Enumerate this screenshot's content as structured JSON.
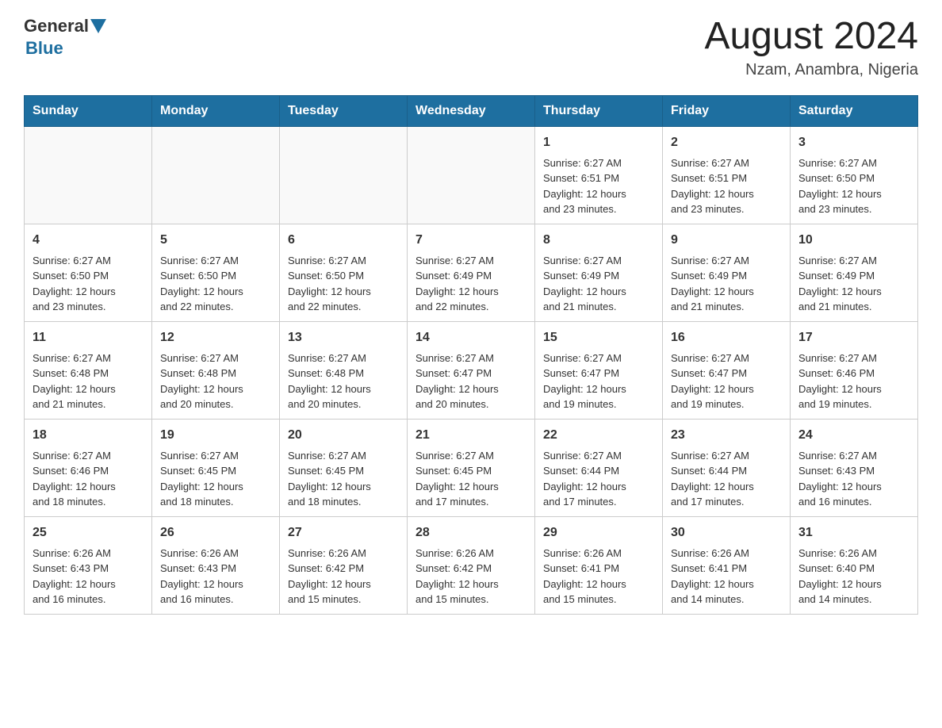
{
  "header": {
    "logo_general": "General",
    "logo_blue": "Blue",
    "month_year": "August 2024",
    "location": "Nzam, Anambra, Nigeria"
  },
  "weekdays": [
    "Sunday",
    "Monday",
    "Tuesday",
    "Wednesday",
    "Thursday",
    "Friday",
    "Saturday"
  ],
  "weeks": [
    [
      {
        "day": "",
        "info": ""
      },
      {
        "day": "",
        "info": ""
      },
      {
        "day": "",
        "info": ""
      },
      {
        "day": "",
        "info": ""
      },
      {
        "day": "1",
        "info": "Sunrise: 6:27 AM\nSunset: 6:51 PM\nDaylight: 12 hours\nand 23 minutes."
      },
      {
        "day": "2",
        "info": "Sunrise: 6:27 AM\nSunset: 6:51 PM\nDaylight: 12 hours\nand 23 minutes."
      },
      {
        "day": "3",
        "info": "Sunrise: 6:27 AM\nSunset: 6:50 PM\nDaylight: 12 hours\nand 23 minutes."
      }
    ],
    [
      {
        "day": "4",
        "info": "Sunrise: 6:27 AM\nSunset: 6:50 PM\nDaylight: 12 hours\nand 23 minutes."
      },
      {
        "day": "5",
        "info": "Sunrise: 6:27 AM\nSunset: 6:50 PM\nDaylight: 12 hours\nand 22 minutes."
      },
      {
        "day": "6",
        "info": "Sunrise: 6:27 AM\nSunset: 6:50 PM\nDaylight: 12 hours\nand 22 minutes."
      },
      {
        "day": "7",
        "info": "Sunrise: 6:27 AM\nSunset: 6:49 PM\nDaylight: 12 hours\nand 22 minutes."
      },
      {
        "day": "8",
        "info": "Sunrise: 6:27 AM\nSunset: 6:49 PM\nDaylight: 12 hours\nand 21 minutes."
      },
      {
        "day": "9",
        "info": "Sunrise: 6:27 AM\nSunset: 6:49 PM\nDaylight: 12 hours\nand 21 minutes."
      },
      {
        "day": "10",
        "info": "Sunrise: 6:27 AM\nSunset: 6:49 PM\nDaylight: 12 hours\nand 21 minutes."
      }
    ],
    [
      {
        "day": "11",
        "info": "Sunrise: 6:27 AM\nSunset: 6:48 PM\nDaylight: 12 hours\nand 21 minutes."
      },
      {
        "day": "12",
        "info": "Sunrise: 6:27 AM\nSunset: 6:48 PM\nDaylight: 12 hours\nand 20 minutes."
      },
      {
        "day": "13",
        "info": "Sunrise: 6:27 AM\nSunset: 6:48 PM\nDaylight: 12 hours\nand 20 minutes."
      },
      {
        "day": "14",
        "info": "Sunrise: 6:27 AM\nSunset: 6:47 PM\nDaylight: 12 hours\nand 20 minutes."
      },
      {
        "day": "15",
        "info": "Sunrise: 6:27 AM\nSunset: 6:47 PM\nDaylight: 12 hours\nand 19 minutes."
      },
      {
        "day": "16",
        "info": "Sunrise: 6:27 AM\nSunset: 6:47 PM\nDaylight: 12 hours\nand 19 minutes."
      },
      {
        "day": "17",
        "info": "Sunrise: 6:27 AM\nSunset: 6:46 PM\nDaylight: 12 hours\nand 19 minutes."
      }
    ],
    [
      {
        "day": "18",
        "info": "Sunrise: 6:27 AM\nSunset: 6:46 PM\nDaylight: 12 hours\nand 18 minutes."
      },
      {
        "day": "19",
        "info": "Sunrise: 6:27 AM\nSunset: 6:45 PM\nDaylight: 12 hours\nand 18 minutes."
      },
      {
        "day": "20",
        "info": "Sunrise: 6:27 AM\nSunset: 6:45 PM\nDaylight: 12 hours\nand 18 minutes."
      },
      {
        "day": "21",
        "info": "Sunrise: 6:27 AM\nSunset: 6:45 PM\nDaylight: 12 hours\nand 17 minutes."
      },
      {
        "day": "22",
        "info": "Sunrise: 6:27 AM\nSunset: 6:44 PM\nDaylight: 12 hours\nand 17 minutes."
      },
      {
        "day": "23",
        "info": "Sunrise: 6:27 AM\nSunset: 6:44 PM\nDaylight: 12 hours\nand 17 minutes."
      },
      {
        "day": "24",
        "info": "Sunrise: 6:27 AM\nSunset: 6:43 PM\nDaylight: 12 hours\nand 16 minutes."
      }
    ],
    [
      {
        "day": "25",
        "info": "Sunrise: 6:26 AM\nSunset: 6:43 PM\nDaylight: 12 hours\nand 16 minutes."
      },
      {
        "day": "26",
        "info": "Sunrise: 6:26 AM\nSunset: 6:43 PM\nDaylight: 12 hours\nand 16 minutes."
      },
      {
        "day": "27",
        "info": "Sunrise: 6:26 AM\nSunset: 6:42 PM\nDaylight: 12 hours\nand 15 minutes."
      },
      {
        "day": "28",
        "info": "Sunrise: 6:26 AM\nSunset: 6:42 PM\nDaylight: 12 hours\nand 15 minutes."
      },
      {
        "day": "29",
        "info": "Sunrise: 6:26 AM\nSunset: 6:41 PM\nDaylight: 12 hours\nand 15 minutes."
      },
      {
        "day": "30",
        "info": "Sunrise: 6:26 AM\nSunset: 6:41 PM\nDaylight: 12 hours\nand 14 minutes."
      },
      {
        "day": "31",
        "info": "Sunrise: 6:26 AM\nSunset: 6:40 PM\nDaylight: 12 hours\nand 14 minutes."
      }
    ]
  ]
}
